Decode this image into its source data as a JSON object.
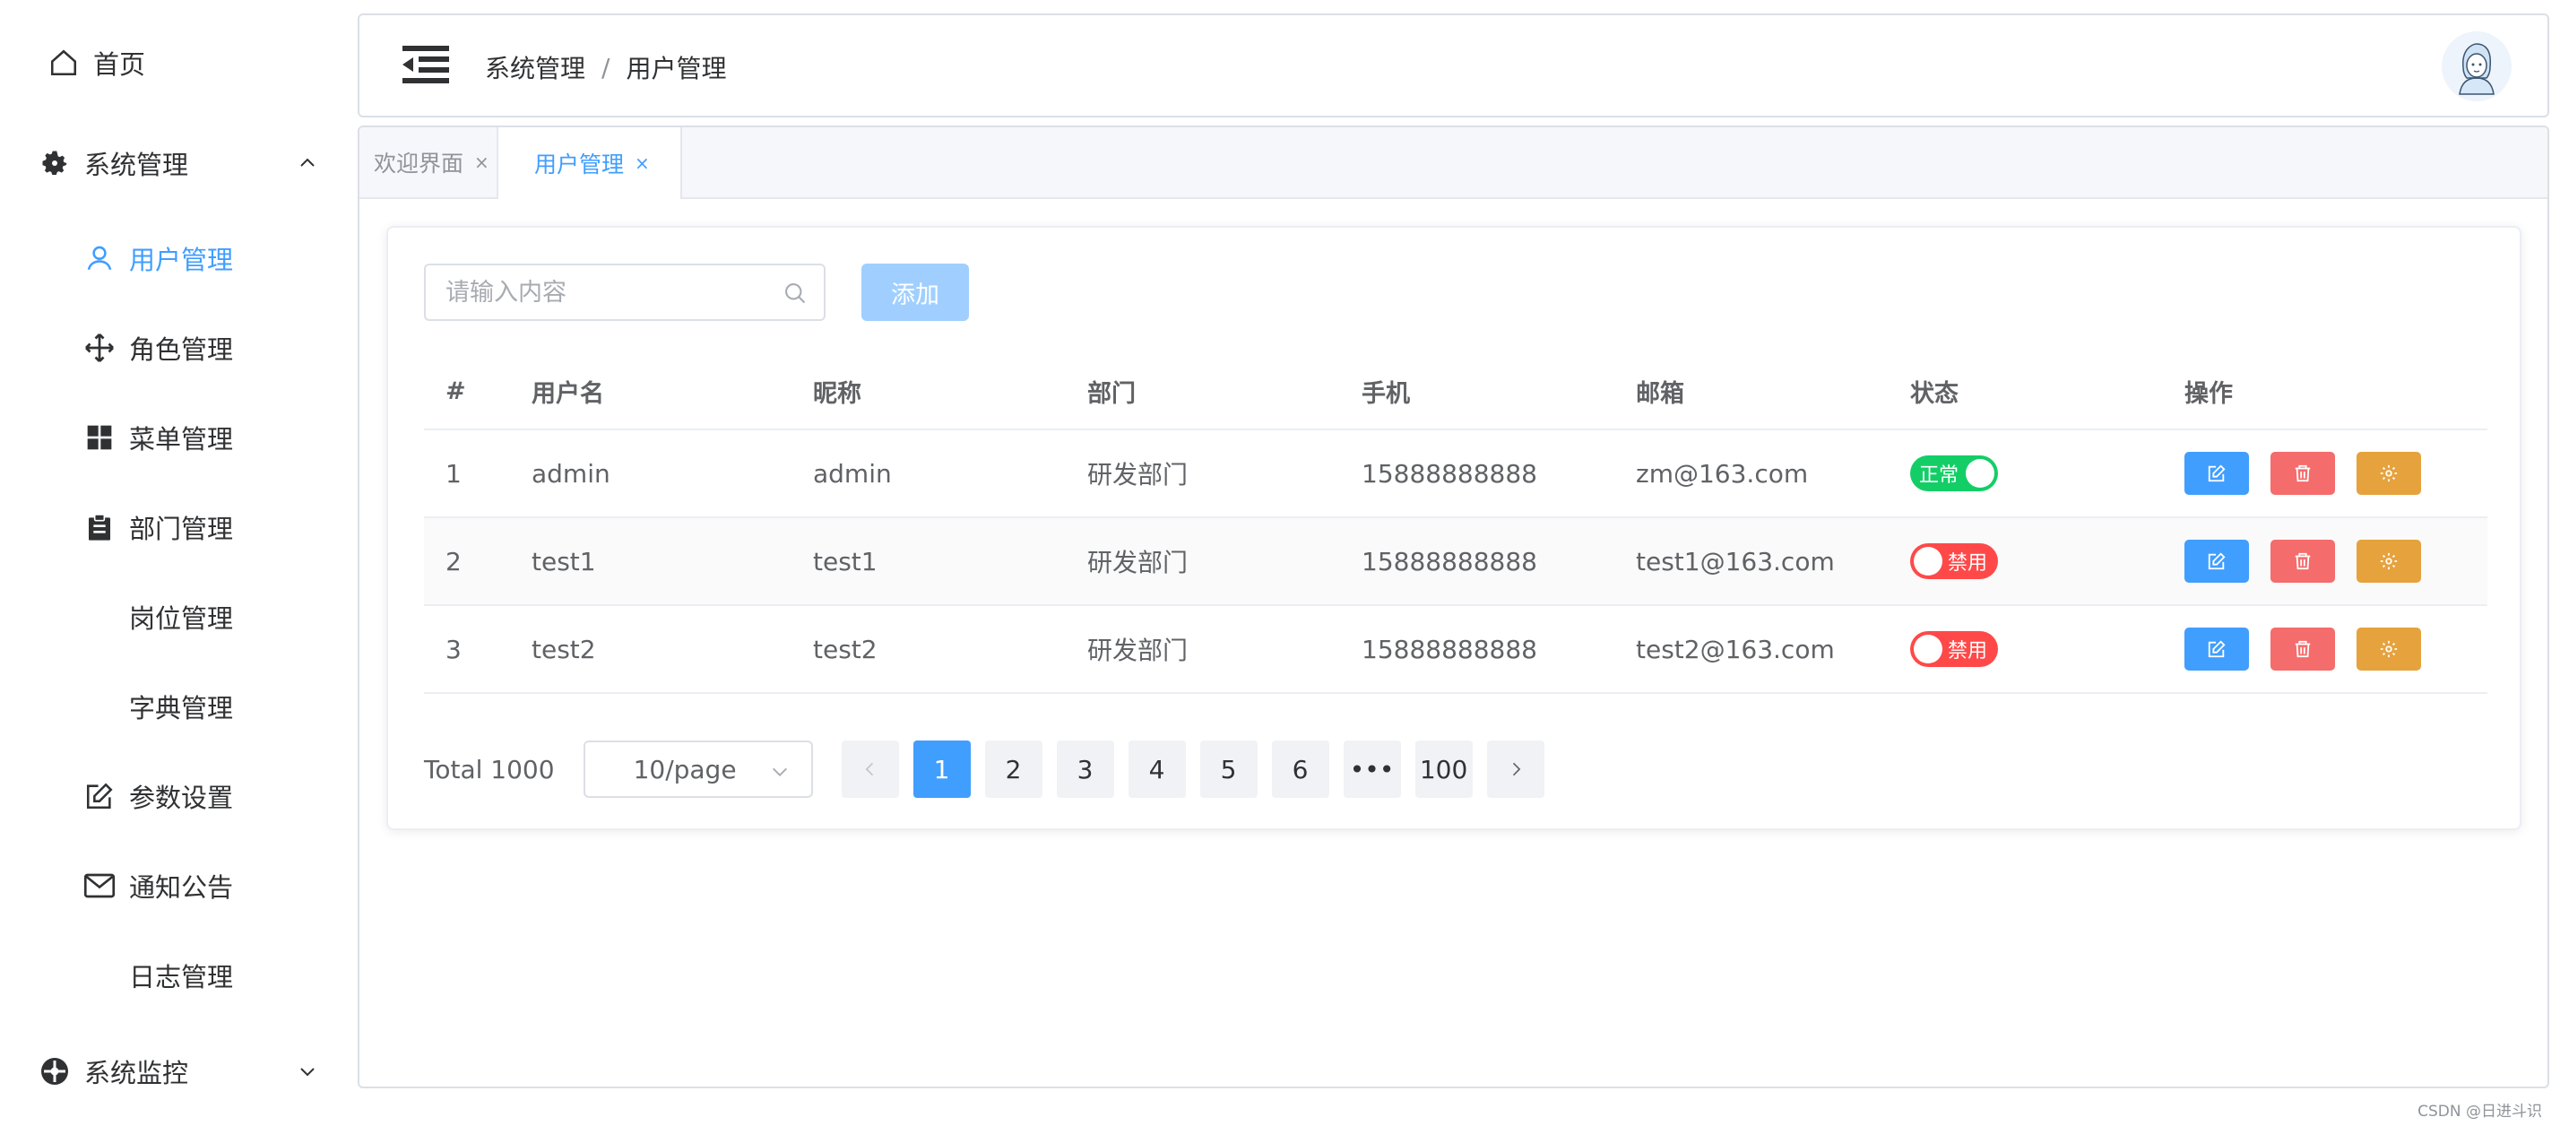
{
  "sidebar": {
    "items": [
      {
        "label": "首页",
        "icon": "home-icon"
      },
      {
        "label": "系统管理",
        "icon": "gear-icon"
      },
      {
        "label": "用户管理",
        "icon": "user-icon"
      },
      {
        "label": "角色管理",
        "icon": "move-icon"
      },
      {
        "label": "菜单管理",
        "icon": "grid-icon"
      },
      {
        "label": "部门管理",
        "icon": "clipboard-icon"
      },
      {
        "label": "岗位管理",
        "icon": ""
      },
      {
        "label": "字典管理",
        "icon": ""
      },
      {
        "label": "参数设置",
        "icon": "edit-icon"
      },
      {
        "label": "通知公告",
        "icon": "mail-icon"
      },
      {
        "label": "日志管理",
        "icon": ""
      },
      {
        "label": "系统监控",
        "icon": "monitor-icon"
      }
    ]
  },
  "header": {
    "breadcrumb": [
      "系统管理",
      "/",
      "用户管理"
    ]
  },
  "tabs": [
    {
      "label": "欢迎界面",
      "close": "×"
    },
    {
      "label": "用户管理",
      "close": "×"
    }
  ],
  "toolbar": {
    "search_placeholder": "请输入内容",
    "add_label": "添加"
  },
  "table": {
    "columns": [
      "#",
      "用户名",
      "昵称",
      "部门",
      "手机",
      "邮箱",
      "状态",
      "操作"
    ],
    "rows": [
      {
        "index": "1",
        "username": "admin",
        "nickname": "admin",
        "dept": "研发部门",
        "phone": "15888888888",
        "email": "zm@163.com",
        "status": "正常",
        "enabled": true
      },
      {
        "index": "2",
        "username": "test1",
        "nickname": "test1",
        "dept": "研发部门",
        "phone": "15888888888",
        "email": "test1@163.com",
        "status": "禁用",
        "enabled": false
      },
      {
        "index": "3",
        "username": "test2",
        "nickname": "test2",
        "dept": "研发部门",
        "phone": "15888888888",
        "email": "test2@163.com",
        "status": "禁用",
        "enabled": false
      }
    ]
  },
  "pagination": {
    "total_label": "Total 1000",
    "page_size": "10/page",
    "pages": [
      "1",
      "2",
      "3",
      "4",
      "5",
      "6",
      "•••",
      "100"
    ],
    "current": "1"
  },
  "watermark": "CSDN @日进斗识",
  "colors": {
    "primary": "#409eff",
    "success": "#13ce66",
    "danger": "#ff4949",
    "warning": "#e6a23c"
  }
}
